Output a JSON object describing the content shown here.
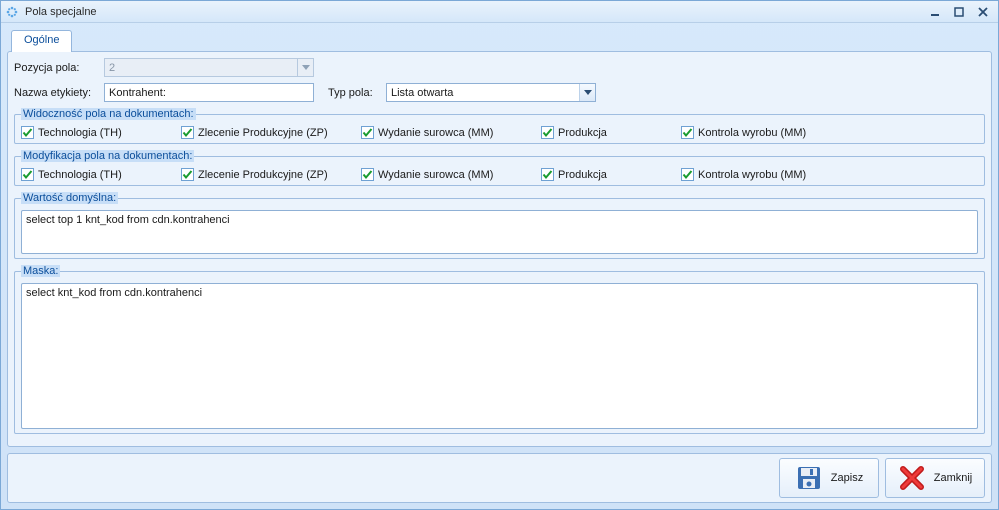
{
  "window": {
    "title": "Pola specjalne"
  },
  "tabs": [
    {
      "label": "Ogólne"
    }
  ],
  "form": {
    "pozycja_label": "Pozycja pola:",
    "pozycja_value": "2",
    "nazwa_label": "Nazwa etykiety:",
    "nazwa_value": "Kontrahent:",
    "typ_label": "Typ pola:",
    "typ_value": "Lista otwarta"
  },
  "visibility": {
    "legend": "Widoczność pola na dokumentach:",
    "items": [
      {
        "label": "Technologia (TH)",
        "checked": true
      },
      {
        "label": "Zlecenie Produkcyjne (ZP)",
        "checked": true
      },
      {
        "label": "Wydanie surowca (MM)",
        "checked": true
      },
      {
        "label": "Produkcja",
        "checked": true
      },
      {
        "label": "Kontrola wyrobu (MM)",
        "checked": true
      }
    ]
  },
  "modification": {
    "legend": "Modyfikacja pola na dokumentach:",
    "items": [
      {
        "label": "Technologia (TH)",
        "checked": true
      },
      {
        "label": "Zlecenie Produkcyjne (ZP)",
        "checked": true
      },
      {
        "label": "Wydanie surowca (MM)",
        "checked": true
      },
      {
        "label": "Produkcja",
        "checked": true
      },
      {
        "label": "Kontrola wyrobu (MM)",
        "checked": true
      }
    ]
  },
  "default_value": {
    "legend": "Wartość domyślna:",
    "text": "select top 1  knt_kod from cdn.kontrahenci"
  },
  "mask": {
    "legend": "Maska:",
    "text": "select knt_kod from cdn.kontrahenci"
  },
  "footer": {
    "save_label": "Zapisz",
    "close_label": "Zamknij"
  }
}
